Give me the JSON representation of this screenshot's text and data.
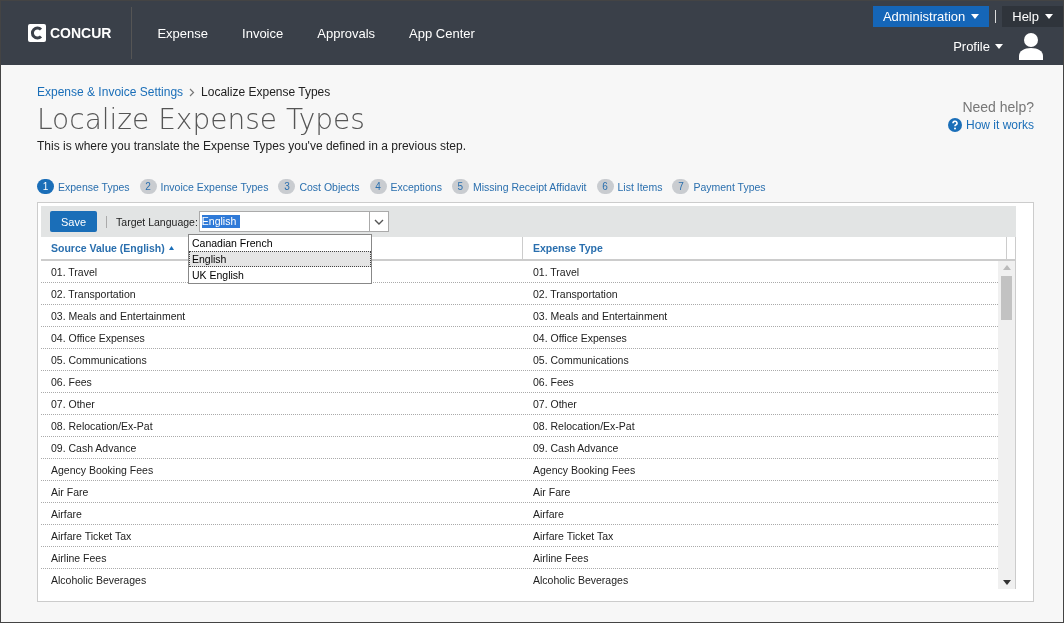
{
  "nav": {
    "logo": "CONCUR",
    "items": [
      "Expense",
      "Invoice",
      "Approvals",
      "App Center"
    ],
    "admin": "Administration",
    "help": "Help",
    "profile": "Profile"
  },
  "breadcrumb": {
    "parent": "Expense & Invoice Settings",
    "current": "Localize Expense Types"
  },
  "title": "Localize Expense Types",
  "description": "This is where you translate the Expense Types you've defined in a previous step.",
  "help": {
    "heading": "Need help?",
    "link": "How it works"
  },
  "steps": [
    {
      "number": "1",
      "label": "Expense Types",
      "selected": true
    },
    {
      "number": "2",
      "label": "Invoice Expense Types",
      "selected": false
    },
    {
      "number": "3",
      "label": "Cost Objects",
      "selected": false
    },
    {
      "number": "4",
      "label": "Exceptions",
      "selected": false
    },
    {
      "number": "5",
      "label": "Missing Receipt Affidavit",
      "selected": false
    },
    {
      "number": "6",
      "label": "List Items",
      "selected": false
    },
    {
      "number": "7",
      "label": "Payment Types",
      "selected": false
    }
  ],
  "toolbar": {
    "save": "Save",
    "language_label": "Target Language:",
    "language_value": "English"
  },
  "dropdown": [
    {
      "label": "Canadian French",
      "selected": false
    },
    {
      "label": "English",
      "selected": true
    },
    {
      "label": "UK English",
      "selected": false
    }
  ],
  "table": {
    "columns": [
      "Source Value (English)",
      "Expense Type"
    ],
    "rows": [
      [
        "01. Travel",
        "01. Travel"
      ],
      [
        "02. Transportation",
        "02. Transportation"
      ],
      [
        "03. Meals and Entertainment",
        "03. Meals and Entertainment"
      ],
      [
        "04. Office Expenses",
        "04. Office Expenses"
      ],
      [
        "05. Communications",
        "05. Communications"
      ],
      [
        "06. Fees",
        "06. Fees"
      ],
      [
        "07. Other",
        "07. Other"
      ],
      [
        "08. Relocation/Ex-Pat",
        "08. Relocation/Ex-Pat"
      ],
      [
        "09. Cash Advance",
        "09. Cash Advance"
      ],
      [
        "Agency Booking Fees",
        "Agency Booking Fees"
      ],
      [
        "Air Fare",
        "Air Fare"
      ],
      [
        "Airfare",
        "Airfare"
      ],
      [
        "Airfare Ticket Tax",
        "Airfare Ticket Tax"
      ],
      [
        "Airline Fees",
        "Airline Fees"
      ],
      [
        "Alcoholic Beverages",
        "Alcoholic Beverages"
      ]
    ]
  }
}
